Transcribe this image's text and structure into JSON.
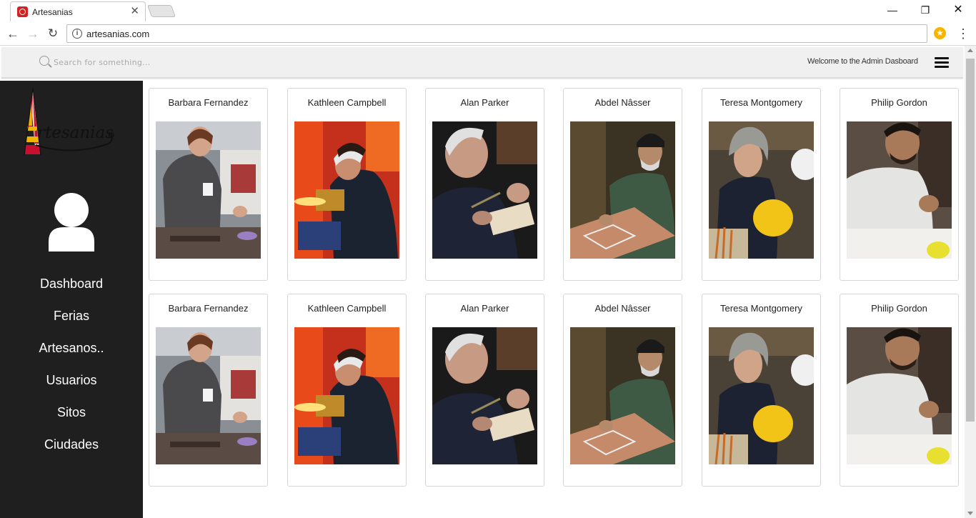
{
  "browser": {
    "tab_title": "Artesanias",
    "url": "artesanias.com",
    "icons": {
      "back": "arrow-left-icon",
      "forward": "arrow-right-icon",
      "reload": "reload-icon",
      "info": "info-icon",
      "extension": "star-extension-icon",
      "menu": "vertical-dots-icon"
    }
  },
  "topbar": {
    "search_placeholder": "Search for something...",
    "welcome": "Welcome to the Admin Dasboard"
  },
  "sidebar": {
    "logo_text": "rtesanias",
    "items": [
      {
        "label": "Dashboard"
      },
      {
        "label": "Ferias"
      },
      {
        "label": "Artesanos.."
      },
      {
        "label": "Usuarios"
      },
      {
        "label": "Sitos"
      },
      {
        "label": "Ciudades"
      }
    ]
  },
  "artisans": [
    {
      "name": "Barbara Fernandez",
      "photo": "woman-grey-sweater-workshop"
    },
    {
      "name": "Kathleen Campbell",
      "photo": "woman-bandana-red-wall"
    },
    {
      "name": "Alan Parker",
      "photo": "older-man-soldering"
    },
    {
      "name": "Abdel Nâsser",
      "photo": "man-cap-inlay-work"
    },
    {
      "name": "Teresa Montgomery",
      "photo": "woman-curly-hair-apron"
    },
    {
      "name": "Philip Gordon",
      "photo": "man-glasses-crafting"
    },
    {
      "name": "Barbara Fernandez",
      "photo": "woman-grey-sweater-workshop"
    },
    {
      "name": "Kathleen Campbell",
      "photo": "woman-bandana-red-wall"
    },
    {
      "name": "Alan Parker",
      "photo": "older-man-soldering"
    },
    {
      "name": "Abdel Nâsser",
      "photo": "man-cap-inlay-work"
    },
    {
      "name": "Teresa Montgomery",
      "photo": "woman-curly-hair-apron"
    },
    {
      "name": "Philip Gordon",
      "photo": "man-glasses-crafting"
    }
  ]
}
